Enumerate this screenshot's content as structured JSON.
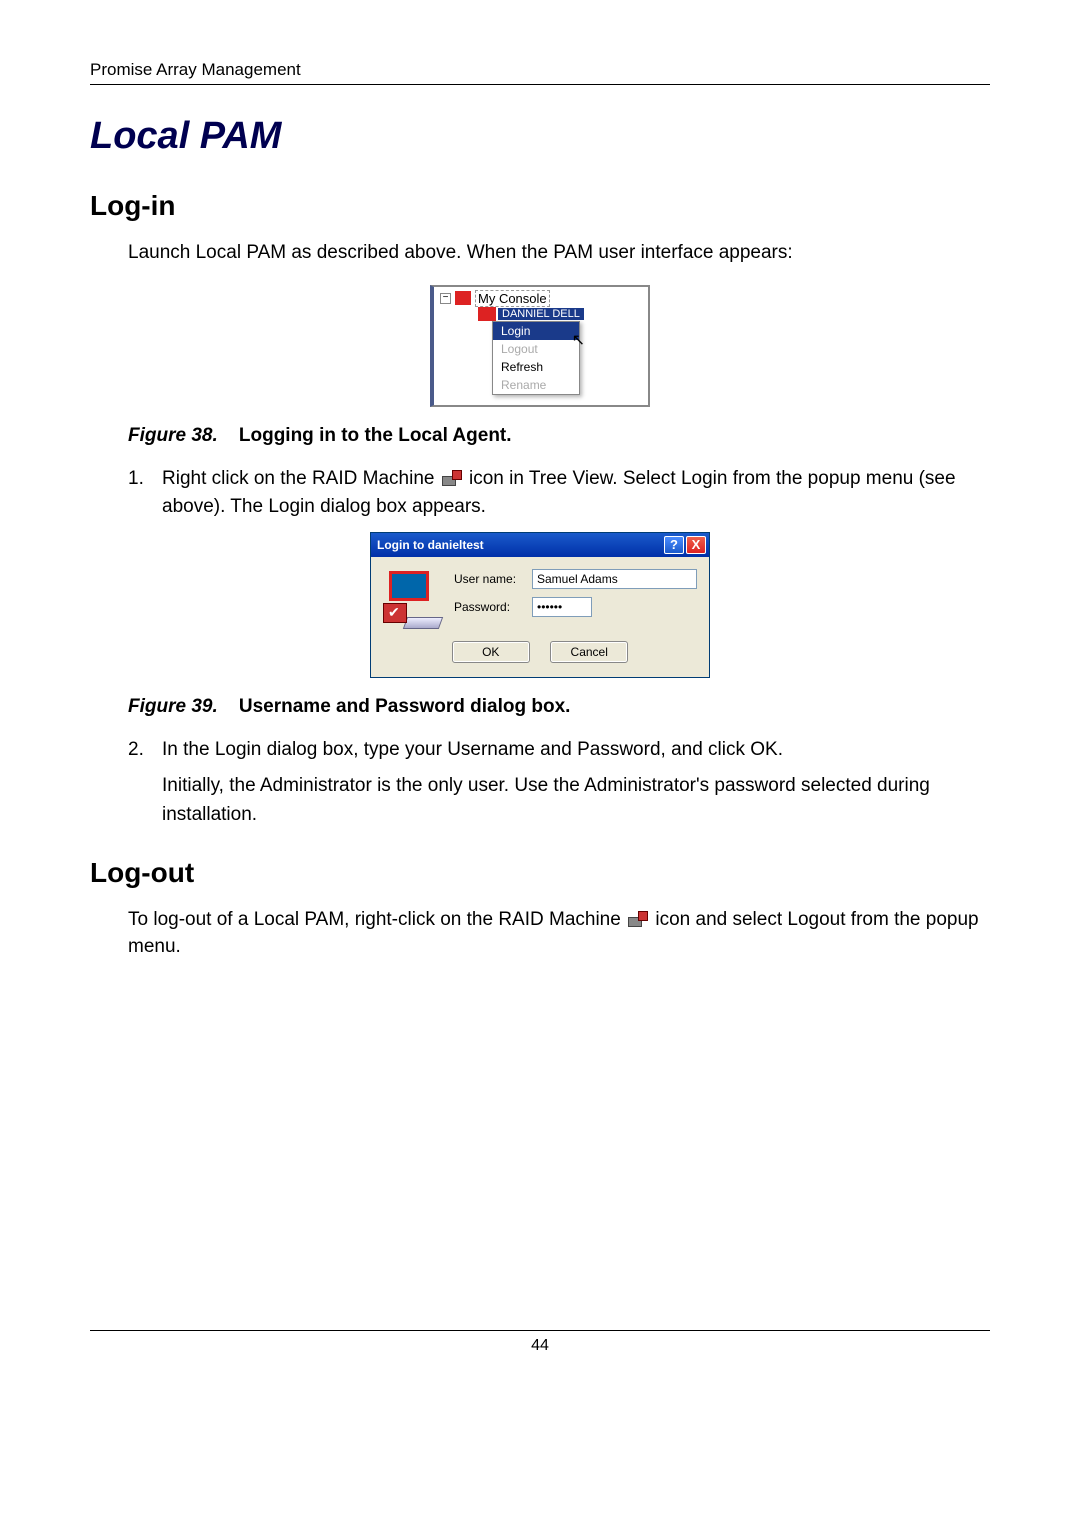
{
  "header": "Promise Array Management",
  "title": "Local PAM",
  "section1": {
    "heading": "Log-in",
    "intro": "Launch Local PAM as described above. When the PAM user interface appears:"
  },
  "contextMenu": {
    "consoleLabel": "My Console",
    "subLabel": "DANNIEL DELL",
    "items": {
      "login": "Login",
      "logout": "Logout",
      "refresh": "Refresh",
      "rename": "Rename"
    }
  },
  "figure38": {
    "label": "Figure 38.",
    "text": "Logging in to the Local Agent."
  },
  "step1": {
    "num": "1.",
    "part1": "Right click on the RAID Machine ",
    "part2": " icon in Tree View. Select Login from the popup menu (see above). The Login dialog box appears."
  },
  "loginDialog": {
    "title": "Login to danieltest",
    "usernameLabel": "User name:",
    "usernameValue": "Samuel Adams",
    "passwordLabel": "Password:",
    "passwordValue": "******",
    "okLabel": "OK",
    "cancelLabel": "Cancel",
    "helpChar": "?",
    "closeChar": "X"
  },
  "figure39": {
    "label": "Figure 39.",
    "text": "Username and Password dialog box."
  },
  "step2": {
    "num": "2.",
    "line1": "In the Login dialog box, type your Username and Password, and click OK.",
    "line2": "Initially, the Administrator is the only user. Use the Administrator's password selected during installation."
  },
  "section2": {
    "heading": "Log-out",
    "part1": "To log-out of a Local PAM, right-click on the RAID Machine ",
    "part2": " icon and select Logout from the popup menu."
  },
  "pageNumber": "44"
}
